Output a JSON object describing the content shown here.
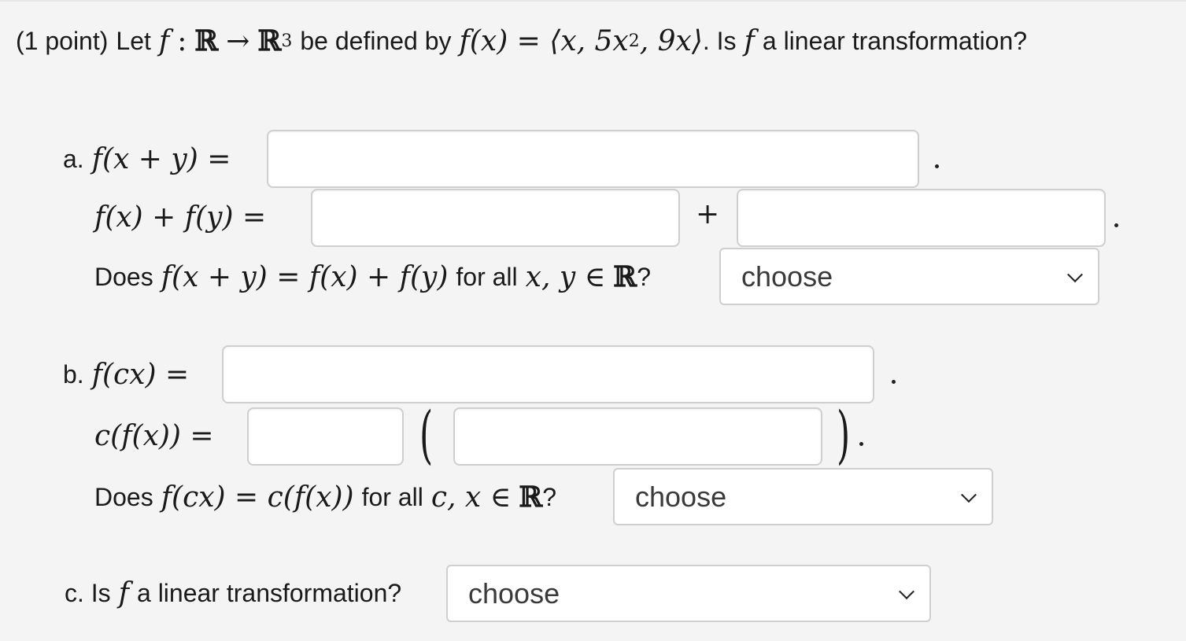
{
  "header": {
    "points": "(1 point)",
    "let": "Let",
    "f": "f",
    "colon": ":",
    "R": "ℝ",
    "arrow": "→",
    "R3": "ℝ",
    "cube": "3",
    "defined_by": "be defined by",
    "fx": "f(x) = ⟨x, 5x",
    "sq": "2",
    "rest": ", 9x⟩",
    "question_pre": ". Is",
    "question_f": "f",
    "question_post": "a linear transformation?"
  },
  "part_a": {
    "label": "a.",
    "lhs1": "f(x + y) =",
    "lhs2": "f(x) + f(y) =",
    "plus": "+",
    "q_does": "Does",
    "q_math": "f(x + y) = f(x) + f(y)",
    "q_forall": "for all",
    "q_vars": "x, y ∈",
    "q_R": "ℝ",
    "q_mark": "?",
    "select_value": "choose",
    "inputs": [
      "",
      "",
      ""
    ]
  },
  "part_b": {
    "label": "b.",
    "lhs1": "f(cx) =",
    "lhs2": "c(f(x)) =",
    "q_does": "Does",
    "q_math": "f(cx) = c(f(x))",
    "q_forall": "for all",
    "q_vars": "c, x ∈",
    "q_R": "ℝ",
    "q_mark": "?",
    "select_value": "choose",
    "inputs": [
      "",
      "",
      ""
    ]
  },
  "part_c": {
    "label": "c. Is",
    "f": "f",
    "text": "a linear transformation?",
    "select_value": "choose"
  }
}
